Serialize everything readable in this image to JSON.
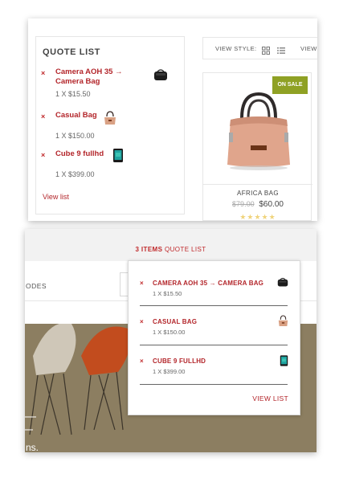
{
  "quote_widget": {
    "title": "QUOTE LIST",
    "items": [
      {
        "name": "Camera AOH 35 → Camera Bag",
        "qty": "1 X $15.50",
        "remove": "×",
        "thumb_icon": "camera-bag-icon"
      },
      {
        "name": "Casual Bag",
        "qty": "1 X $150.00",
        "remove": "×",
        "thumb_icon": "handbag-icon"
      },
      {
        "name": "Cube 9 fullhd",
        "qty": "1 X $399.00",
        "remove": "×",
        "thumb_icon": "phone-icon"
      }
    ],
    "view_list": "View list"
  },
  "toolbar": {
    "view_style_label": "VIEW STYLE:",
    "view_truncated": "VIEW"
  },
  "product": {
    "badge": "ON SALE",
    "name": "AFRICA BAG",
    "old_price": "$79.00",
    "new_price": "$60.00",
    "rating_glyphs": "★★★★★"
  },
  "header_quote": {
    "count": "3 ITEMS",
    "label": "QUOTE LIST"
  },
  "dropdown": {
    "items": [
      {
        "name": "CAMERA AOH 35 → CAMERA BAG",
        "qty": "1 X $15.50",
        "remove": "×",
        "thumb_icon": "camera-bag-icon"
      },
      {
        "name": "CASUAL BAG",
        "qty": "1 X $150.00",
        "remove": "×",
        "thumb_icon": "handbag-icon"
      },
      {
        "name": "CUBE 9 FULLHD",
        "qty": "1 X $399.00",
        "remove": "×",
        "thumb_icon": "phone-icon"
      }
    ],
    "view_list": "VIEW LIST"
  },
  "background": {
    "nav_text": "ODES",
    "hero_text": "ns."
  },
  "colors": {
    "accent_red": "#b3252a",
    "sale_green": "#8fa124",
    "hero_tan": "#8c7e61"
  }
}
